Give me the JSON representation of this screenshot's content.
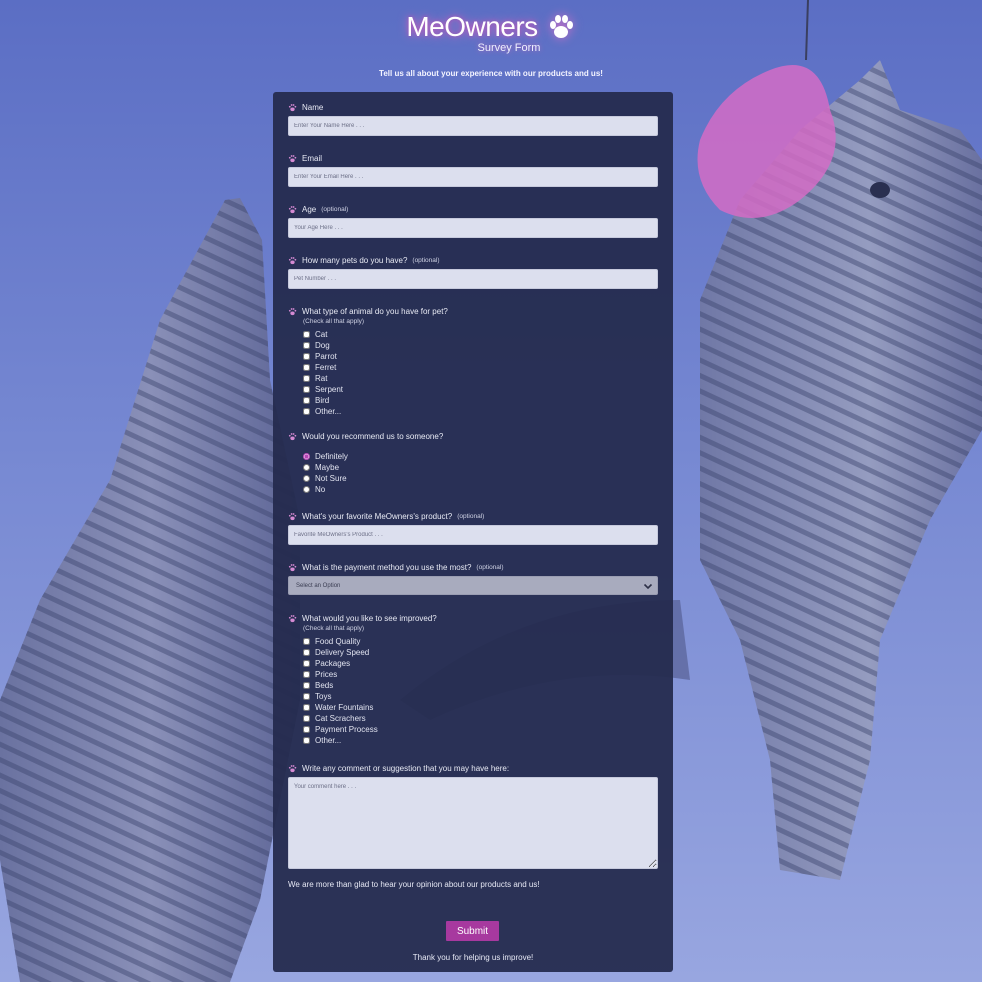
{
  "header": {
    "title": "MeOwners",
    "subtitle": "Survey Form",
    "tagline": "Tell us all about your experience with our products and us!"
  },
  "form": {
    "name": {
      "label": "Name",
      "placeholder": "Enter Your Name Here . . ."
    },
    "email": {
      "label": "Email",
      "placeholder": "Enter Your Email Here . . ."
    },
    "age": {
      "label": "Age",
      "optional": "(optional)",
      "placeholder": "Your Age Here . . ."
    },
    "pets": {
      "label": "How many pets do you have?",
      "optional": "(optional)",
      "placeholder": "Pet Number . . ."
    },
    "animals": {
      "label": "What type of animal do you have for pet?",
      "hint": "(Check all that apply)",
      "options": [
        "Cat",
        "Dog",
        "Parrot",
        "Ferret",
        "Rat",
        "Serpent",
        "Bird",
        "Other..."
      ]
    },
    "recommend": {
      "label": "Would you recommend us to someone?",
      "options": [
        "Definitely",
        "Maybe",
        "Not Sure",
        "No"
      ],
      "selected": "Definitely"
    },
    "favorite": {
      "label": "What's your favorite MeOwners's product?",
      "optional": "(optional)",
      "placeholder": "Favorite MeOwners's Product . . ."
    },
    "payment": {
      "label": "What is the payment method you use the most?",
      "optional": "(optional)",
      "selected": "Select an Option"
    },
    "improve": {
      "label": "What would you like to see improved?",
      "hint": "(Check all that apply)",
      "options": [
        "Food Quality",
        "Delivery Speed",
        "Packages",
        "Prices",
        "Beds",
        "Toys",
        "Water Fountains",
        "Cat Scrachers",
        "Payment Process",
        "Other..."
      ]
    },
    "comment": {
      "label": "Write any comment or suggestion that you may have here:",
      "placeholder": "Your comment here . . ."
    },
    "glad_text": "We are more than glad to hear your opinion about our products and us!",
    "submit_label": "Submit",
    "thanks_text": "Thank you for helping us improve!"
  },
  "colors": {
    "accent": "#a7399f",
    "panel": "#242a4e",
    "background": "#6b7ecc",
    "paw": "#d58ad3"
  }
}
